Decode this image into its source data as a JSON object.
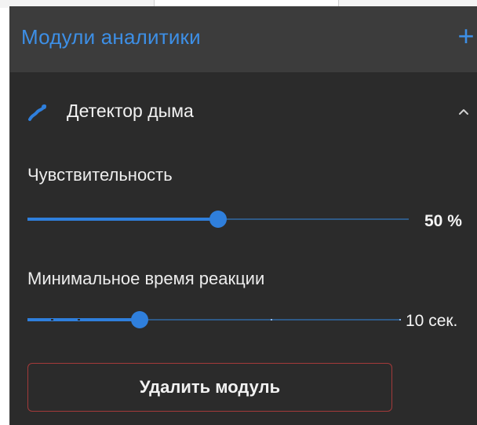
{
  "panel": {
    "title": "Модули аналитики",
    "add_label": "+"
  },
  "module": {
    "name": "Детектор дыма",
    "icon": "smoke-detector-icon",
    "collapse_icon": "chevron-up-icon",
    "sensitivity": {
      "label": "Чувствительность",
      "value_text": "50 %",
      "value_fraction": 0.5
    },
    "reaction_time": {
      "label": "Минимальное время реакции",
      "value_text": "10 сек.",
      "value_fraction": 0.3
    },
    "delete_label": "Удалить модуль"
  },
  "colors": {
    "accent": "#2f7fdc",
    "title": "#3d8fe6",
    "panel_bg": "#2b2b2b",
    "header_bg": "#3c3c3c",
    "danger_border": "#a33a3a"
  }
}
